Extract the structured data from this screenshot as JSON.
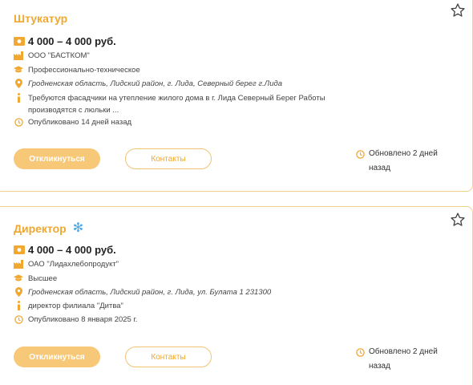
{
  "vacancies": [
    {
      "title": "Штукатур",
      "salary": "4 000 – 4 000 руб.",
      "company": "ООО \"БАСТКОМ\"",
      "education": "Профессионально-техническое",
      "location": "Гродненская область, Лидский район, г. Лида, Северный берег г.Лида",
      "description": "Требуются фасадчики на утепление жилого дома в г. Лида Северный Берег Работы производятся с люльки ...",
      "published": "Опубликовано 14 дней назад",
      "apply_label": "Откликнуться",
      "contacts_label": "Контакты",
      "updated": "Обновлено 2 дней назад"
    },
    {
      "title": "Директор",
      "salary": "4 000 – 4 000 руб.",
      "company": "ОАО \"Лидахлебопродукт\"",
      "education": "Высшее",
      "location": "Гродненская область, Лидский район, г. Лида, ул. Булата 1 231300",
      "description": "директор филиала \"Дитва\"",
      "published": "Опубликовано 8 января 2025 г.",
      "apply_label": "Откликнуться",
      "contacts_label": "Контакты",
      "updated": "Обновлено 2 дней назад"
    }
  ],
  "icons": {
    "salary": "money-icon",
    "company": "factory-icon",
    "education": "graduation-cap-icon",
    "location": "map-pin-icon",
    "description": "info-icon",
    "published": "clock-icon",
    "favorite": "star-icon",
    "featured": "snowflake-icon"
  },
  "colors": {
    "accent": "#f0a830",
    "button_fill": "#f7c878",
    "card_border": "#f1d08a"
  }
}
